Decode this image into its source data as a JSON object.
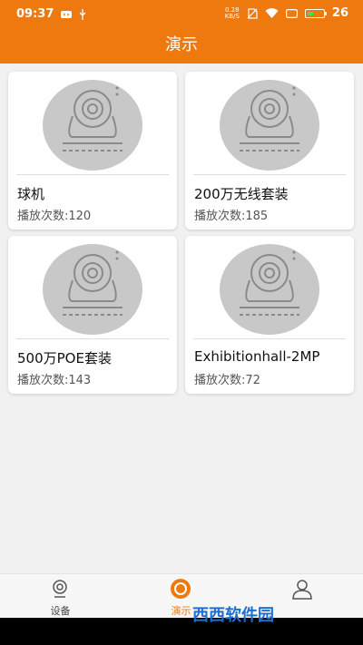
{
  "status_bar": {
    "time": "09:37",
    "net_speed_value": "0.28",
    "net_speed_unit": "KB/S",
    "battery": "26"
  },
  "app_bar": {
    "title": "演示"
  },
  "devices": [
    {
      "title": "球机",
      "plays": "播放次数:120"
    },
    {
      "title": "200万无线套装",
      "plays": "播放次数:185"
    },
    {
      "title": "500万POE套装",
      "plays": "播放次数:143"
    },
    {
      "title": "Exhibitionhall-2MP",
      "plays": "播放次数:72"
    }
  ],
  "bottom_nav": {
    "tabs": [
      {
        "label": "设备",
        "icon": "camera-icon"
      },
      {
        "label": "演示",
        "icon": "demo-icon",
        "active": true
      },
      {
        "label": "",
        "icon": "user-icon"
      }
    ]
  },
  "watermark": "西西软件园",
  "colors": {
    "accent": "#ee7a0f",
    "background": "#f1f1f1"
  }
}
